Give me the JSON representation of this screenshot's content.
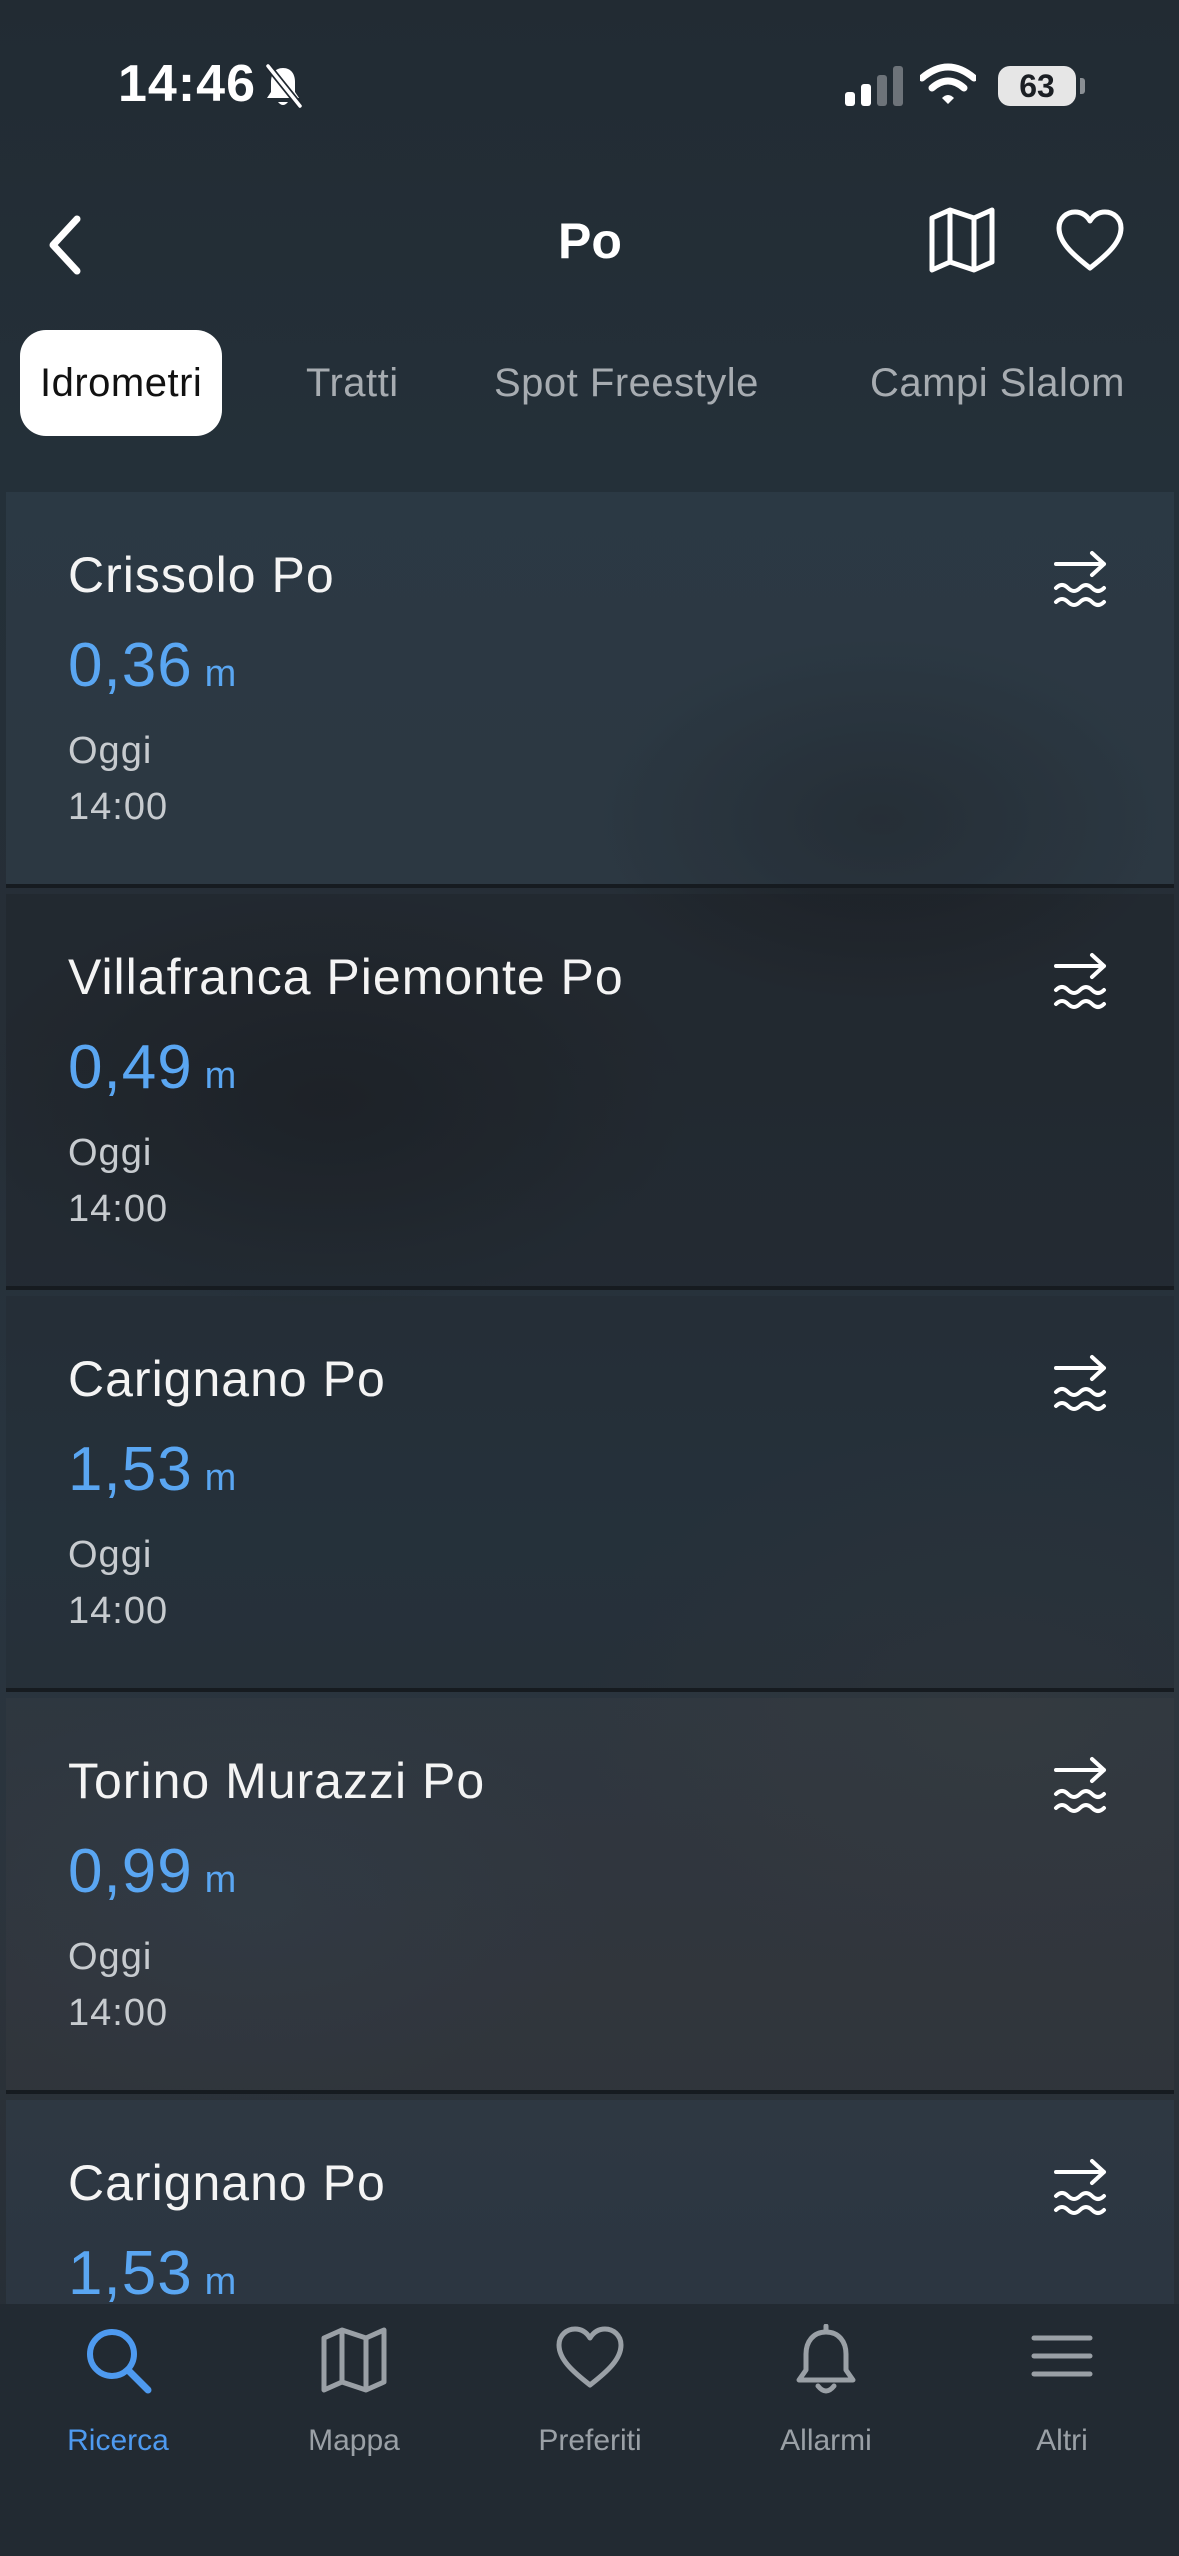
{
  "status_bar": {
    "time": "14:46",
    "battery": "63"
  },
  "header": {
    "title": "Po"
  },
  "tabs": [
    {
      "label": "Idrometri",
      "active": true
    },
    {
      "label": "Tratti"
    },
    {
      "label": "Spot Freestyle"
    },
    {
      "label": "Campi Slalom"
    }
  ],
  "stations": [
    {
      "name": "Crissolo Po",
      "level": "0,36",
      "unit": "m",
      "day": "Oggi",
      "time": "14:00"
    },
    {
      "name": "Villafranca Piemonte Po",
      "level": "0,49",
      "unit": "m",
      "day": "Oggi",
      "time": "14:00"
    },
    {
      "name": "Carignano Po",
      "level": "1,53",
      "unit": "m",
      "day": "Oggi",
      "time": "14:00"
    },
    {
      "name": "Torino Murazzi Po",
      "level": "0,99",
      "unit": "m",
      "day": "Oggi",
      "time": "14:00"
    },
    {
      "name": "Carignano Po",
      "level": "1,53",
      "unit": "m",
      "day": "",
      "time": ""
    }
  ],
  "tabbar": [
    {
      "label": "Ricerca",
      "icon": "search-icon",
      "active": true
    },
    {
      "label": "Mappa",
      "icon": "map-icon"
    },
    {
      "label": "Preferiti",
      "icon": "heart-icon"
    },
    {
      "label": "Allarmi",
      "icon": "bell-icon"
    },
    {
      "label": "Altri",
      "icon": "menu-icon"
    }
  ],
  "colors": {
    "accent": "#4e9af0",
    "level": "#5aa6f2",
    "background": "#1c242c"
  }
}
